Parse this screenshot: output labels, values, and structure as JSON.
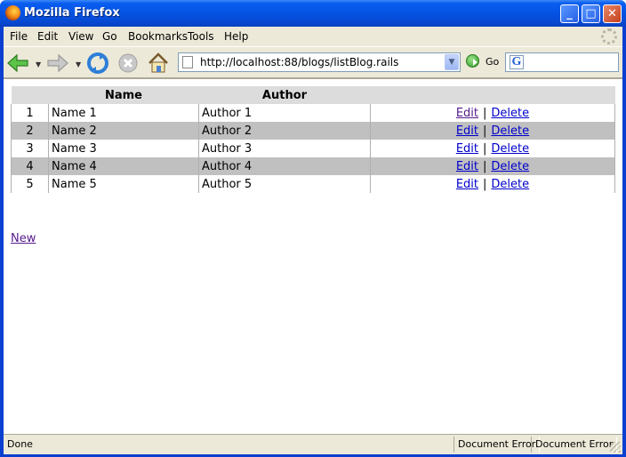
{
  "window": {
    "title": "Mozilla Firefox"
  },
  "menu": [
    "File",
    "Edit",
    "View",
    "Go",
    "Bookmarks",
    "Tools",
    "Help"
  ],
  "navigation": {
    "url": "http://localhost:88/blogs/listBlog.rails",
    "go_label": "Go",
    "search_value": ""
  },
  "table": {
    "headers": [
      "",
      "Name",
      "Author",
      ""
    ],
    "rows": [
      {
        "id": "1",
        "name": "Name 1",
        "author": "Author 1"
      },
      {
        "id": "2",
        "name": "Name 2",
        "author": "Author 2"
      },
      {
        "id": "3",
        "name": "Name 3",
        "author": "Author 3"
      },
      {
        "id": "4",
        "name": "Name 4",
        "author": "Author 4"
      },
      {
        "id": "5",
        "name": "Name 5",
        "author": "Author 5"
      }
    ],
    "edit_label": "Edit",
    "delete_label": "Delete",
    "separator": "|"
  },
  "new_link": "New",
  "status": {
    "text": "Done",
    "panel1": "Document Error",
    "panel2": "Document Error"
  },
  "colors": {
    "titlebar": "#0553e3",
    "row_alt": "#c0c0c0",
    "header": "#dcdcdc",
    "link": "#0000cc",
    "visited": "#551a8b"
  }
}
